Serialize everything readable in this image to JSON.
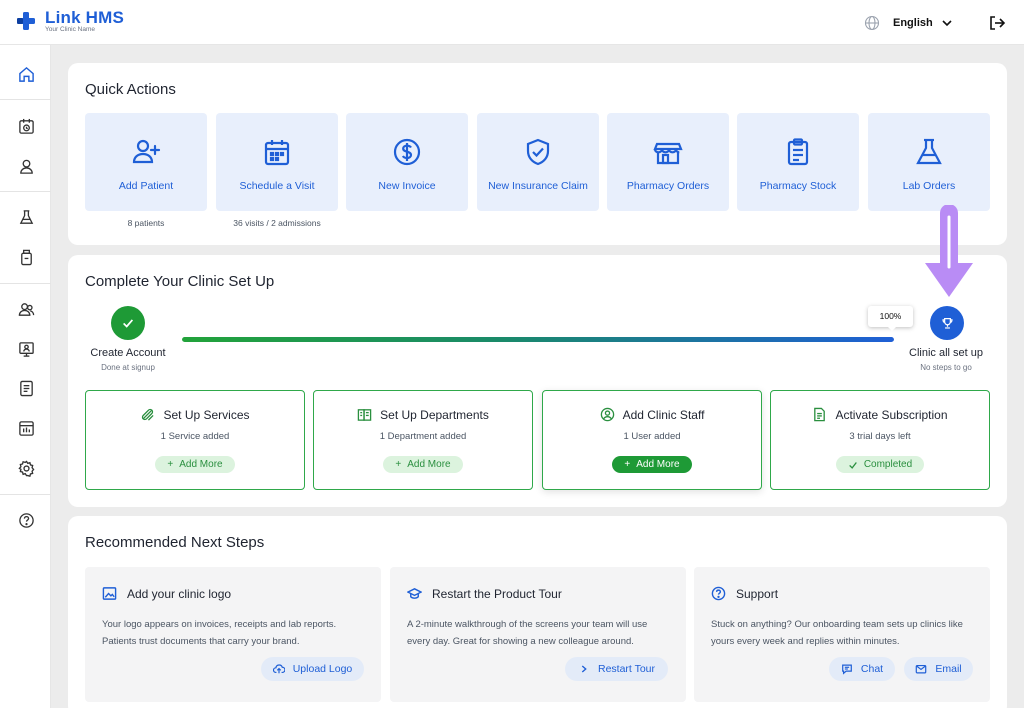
{
  "app": {
    "brand": "Link HMS",
    "clinic_name": "Your Clinic Name",
    "language": "English"
  },
  "quick_actions": {
    "title": "Quick Actions",
    "tiles": [
      {
        "label": "Add Patient",
        "icon": "add-user-icon",
        "sub": "8 patients"
      },
      {
        "label": "Schedule a Visit",
        "icon": "calendar-icon",
        "sub": "36 visits / 2 admissions"
      },
      {
        "label": "New Invoice",
        "icon": "dollar-icon",
        "sub": ""
      },
      {
        "label": "New Insurance Claim",
        "icon": "shield-check-icon",
        "sub": ""
      },
      {
        "label": "Pharmacy Orders",
        "icon": "store-icon",
        "sub": ""
      },
      {
        "label": "Pharmacy Stock",
        "icon": "clipboard-icon",
        "sub": ""
      },
      {
        "label": "Lab Orders",
        "icon": "flask-icon",
        "sub": ""
      }
    ]
  },
  "setup": {
    "title": "Complete Your Clinic Set Up",
    "start": {
      "title": "Create Account",
      "sub": "Done at signup"
    },
    "end": {
      "title": "Clinic all set up",
      "sub": "No steps to go"
    },
    "progress_percent": 100,
    "progress_label": "100%",
    "cards": [
      {
        "title": "Set Up Services",
        "sub": "1 Service added",
        "button": "Add More",
        "icon": "pills-icon"
      },
      {
        "title": "Set Up Departments",
        "sub": "1 Department added",
        "button": "Add More",
        "icon": "departments-icon"
      },
      {
        "title": "Add Clinic Staff",
        "sub": "1 User added",
        "button": "Add More",
        "icon": "user-circle-icon"
      },
      {
        "title": "Activate Subscription",
        "sub": "3 trial days left",
        "button": "Completed",
        "icon": "document-icon"
      }
    ]
  },
  "recommended": {
    "title": "Recommended Next Steps",
    "cards": [
      {
        "title": "Add your clinic logo",
        "body": "Your logo appears on invoices, receipts and lab reports. Patients trust documents that carry your brand.",
        "buttons": [
          "Upload Logo"
        ]
      },
      {
        "title": "Restart the Product Tour",
        "body": "A 2-minute walkthrough of the screens your team will use every day. Great for showing a new colleague around.",
        "buttons": [
          "Restart Tour"
        ]
      },
      {
        "title": "Support",
        "body": "Stuck on anything? Our onboarding team sets up clinics like yours every week and replies within minutes.",
        "buttons": [
          "Chat",
          "Email"
        ]
      }
    ]
  },
  "colors": {
    "primary": "#1f5fd6",
    "success": "#1e9a36",
    "annotation": "#b98cf5"
  }
}
